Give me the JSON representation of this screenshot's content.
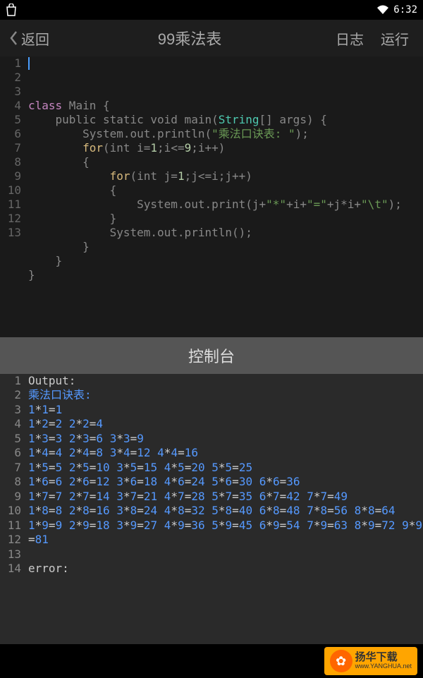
{
  "status": {
    "time": "6:32"
  },
  "toolbar": {
    "back": "返回",
    "title": "99乘法表",
    "log": "日志",
    "run": "运行"
  },
  "editor": {
    "lines": [
      "1",
      "2",
      "3",
      "4",
      "5",
      "6",
      "7",
      "8",
      "9",
      "10",
      "11",
      "12",
      "13"
    ],
    "code_tokens": [
      [
        {
          "t": "class",
          "c": "kw"
        },
        {
          "t": " Main {",
          "c": ""
        }
      ],
      [
        {
          "t": "    public static void main(",
          "c": ""
        },
        {
          "t": "String",
          "c": "type"
        },
        {
          "t": "[] args) {",
          "c": ""
        }
      ],
      [
        {
          "t": "        System.out.println(",
          "c": ""
        },
        {
          "t": "\"乘法口诀表: \"",
          "c": "str"
        },
        {
          "t": ");",
          "c": ""
        }
      ],
      [
        {
          "t": "        ",
          "c": ""
        },
        {
          "t": "for",
          "c": "for-kw"
        },
        {
          "t": "(int i=",
          "c": ""
        },
        {
          "t": "1",
          "c": "num"
        },
        {
          "t": ";i<=",
          "c": ""
        },
        {
          "t": "9",
          "c": "num"
        },
        {
          "t": ";i++)",
          "c": ""
        }
      ],
      [
        {
          "t": "        {",
          "c": ""
        }
      ],
      [
        {
          "t": "            ",
          "c": ""
        },
        {
          "t": "for",
          "c": "for-kw"
        },
        {
          "t": "(int j=",
          "c": ""
        },
        {
          "t": "1",
          "c": "num"
        },
        {
          "t": ";j<=i;j++)",
          "c": ""
        }
      ],
      [
        {
          "t": "            {",
          "c": ""
        }
      ],
      [
        {
          "t": "                System.out.print(j+",
          "c": ""
        },
        {
          "t": "\"*\"",
          "c": "str"
        },
        {
          "t": "+i+",
          "c": ""
        },
        {
          "t": "\"=\"",
          "c": "str"
        },
        {
          "t": "+j*i+",
          "c": ""
        },
        {
          "t": "\"\\t\"",
          "c": "str"
        },
        {
          "t": ");",
          "c": ""
        }
      ],
      [
        {
          "t": "            }",
          "c": ""
        }
      ],
      [
        {
          "t": "            System.out.println();",
          "c": ""
        }
      ],
      [
        {
          "t": "        }",
          "c": ""
        }
      ],
      [
        {
          "t": "    }",
          "c": ""
        }
      ],
      [
        {
          "t": "}",
          "c": ""
        }
      ]
    ]
  },
  "console": {
    "header": "控制台",
    "output_label": "Output:",
    "table_label": "乘法口诀表:",
    "error_label": "error:",
    "lines": [
      "1",
      "2",
      "3",
      "4",
      "5",
      "6",
      "7",
      "8",
      "9",
      "10",
      "11",
      "12",
      "13",
      "14"
    ],
    "table": [
      [
        [
          1,
          1,
          1
        ]
      ],
      [
        [
          1,
          2,
          2
        ],
        [
          2,
          2,
          4
        ]
      ],
      [
        [
          1,
          3,
          3
        ],
        [
          2,
          3,
          6
        ],
        [
          3,
          3,
          9
        ]
      ],
      [
        [
          1,
          4,
          4
        ],
        [
          2,
          4,
          8
        ],
        [
          3,
          4,
          12
        ],
        [
          4,
          4,
          16
        ]
      ],
      [
        [
          1,
          5,
          5
        ],
        [
          2,
          5,
          10
        ],
        [
          3,
          5,
          15
        ],
        [
          4,
          5,
          20
        ],
        [
          5,
          5,
          25
        ]
      ],
      [
        [
          1,
          6,
          6
        ],
        [
          2,
          6,
          12
        ],
        [
          3,
          6,
          18
        ],
        [
          4,
          6,
          24
        ],
        [
          5,
          6,
          30
        ],
        [
          6,
          6,
          36
        ]
      ],
      [
        [
          1,
          7,
          7
        ],
        [
          2,
          7,
          14
        ],
        [
          3,
          7,
          21
        ],
        [
          4,
          7,
          28
        ],
        [
          5,
          7,
          35
        ],
        [
          6,
          7,
          42
        ],
        [
          7,
          7,
          49
        ]
      ],
      [
        [
          1,
          8,
          8
        ],
        [
          2,
          8,
          16
        ],
        [
          3,
          8,
          24
        ],
        [
          4,
          8,
          32
        ],
        [
          5,
          8,
          40
        ],
        [
          6,
          8,
          48
        ],
        [
          7,
          8,
          56
        ],
        [
          8,
          8,
          64
        ]
      ],
      [
        [
          1,
          9,
          9
        ],
        [
          2,
          9,
          18
        ],
        [
          3,
          9,
          27
        ],
        [
          4,
          9,
          36
        ],
        [
          5,
          9,
          45
        ],
        [
          6,
          9,
          54
        ],
        [
          7,
          9,
          63
        ],
        [
          8,
          9,
          72
        ],
        [
          9,
          9,
          81
        ]
      ]
    ]
  },
  "watermark": {
    "name": "扬华下载",
    "url": "www.YANGHUA.net"
  }
}
